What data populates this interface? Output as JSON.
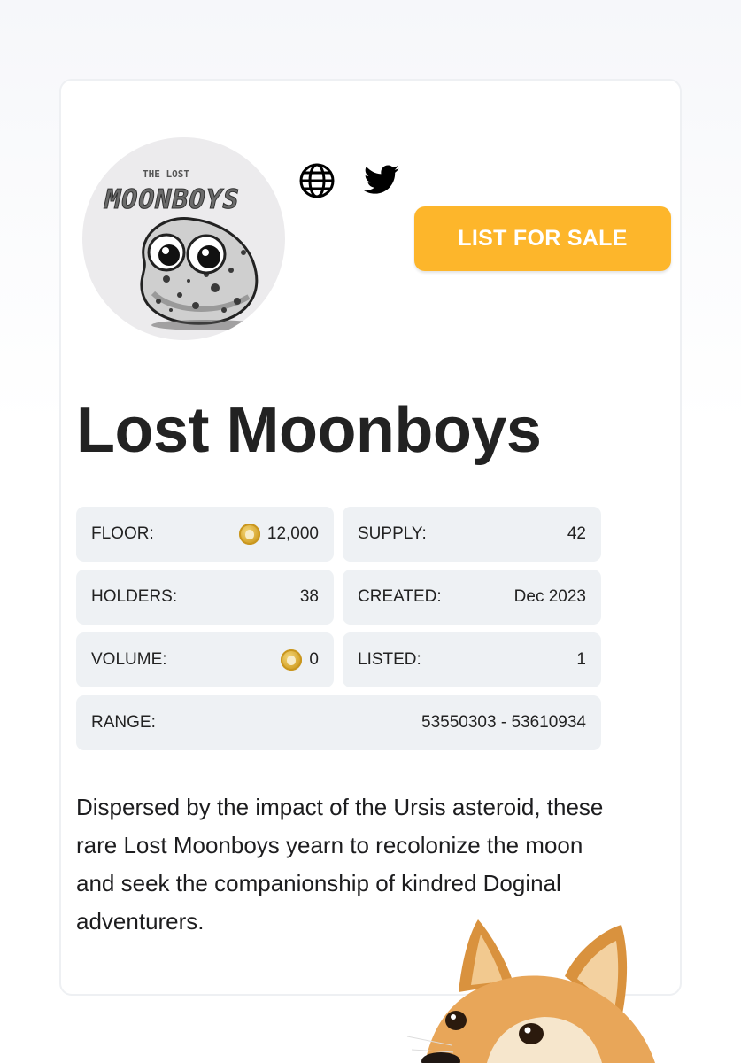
{
  "collection": {
    "logo_text_top": "THE LOST",
    "logo_text_main": "MOONBOYS",
    "name": "Lost Moonboys",
    "description": "Dispersed by the impact of the Ursis asteroid, these rare Lost Moonboys yearn to recolonize the moon and seek the companionship of kindred Doginal adventurers."
  },
  "actions": {
    "list_for_sale": "LIST FOR SALE",
    "website_icon": "globe-icon",
    "twitter_icon": "twitter-icon"
  },
  "stats": {
    "floor": {
      "label": "FLOOR:",
      "value": "12,000",
      "icon": "dogecoin-icon"
    },
    "supply": {
      "label": "SUPPLY:",
      "value": "42"
    },
    "holders": {
      "label": "HOLDERS:",
      "value": "38"
    },
    "created": {
      "label": "CREATED:",
      "value": "Dec 2023"
    },
    "volume": {
      "label": "VOLUME:",
      "value": "0",
      "icon": "dogecoin-icon"
    },
    "listed": {
      "label": "LISTED:",
      "value": "1"
    },
    "range": {
      "label": "RANGE:",
      "value": "53550303 - 53610934"
    }
  },
  "colors": {
    "accent": "#fdb62b",
    "stat_bg": "#eef1f4",
    "coin": "#d6a62e"
  }
}
